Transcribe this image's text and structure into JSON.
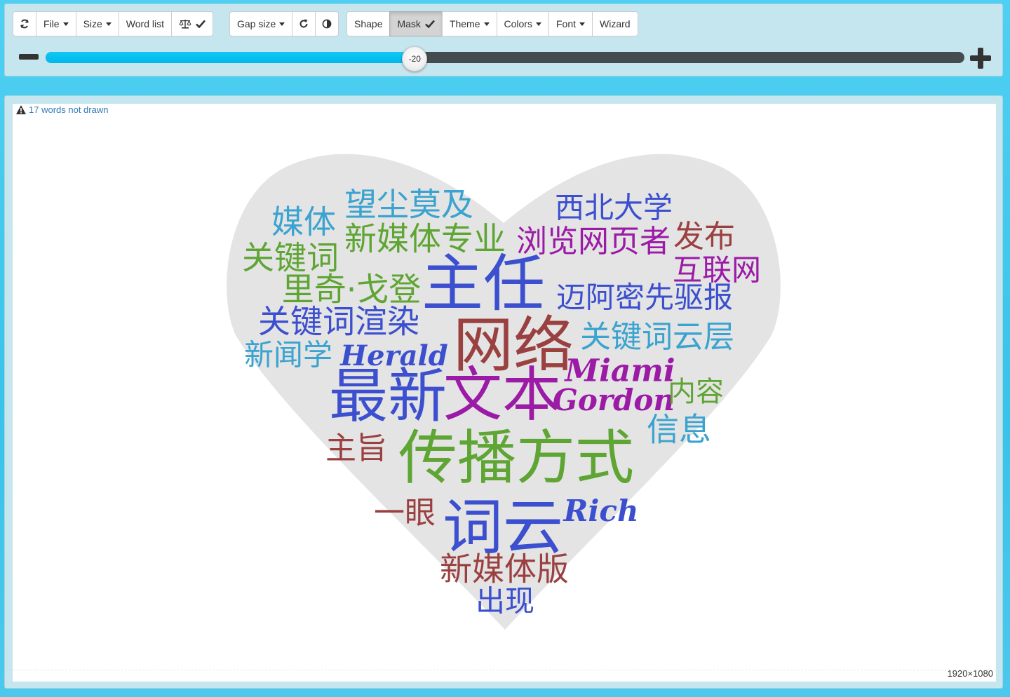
{
  "toolbar": {
    "group1": [
      {
        "name": "refresh-button",
        "icon": "refresh-icon",
        "label": "",
        "caret": false
      },
      {
        "name": "file-menu-button",
        "label": "File",
        "caret": true
      },
      {
        "name": "size-menu-button",
        "label": "Size",
        "caret": true
      },
      {
        "name": "word-list-button",
        "label": "Word list",
        "caret": false
      },
      {
        "name": "balance-button",
        "icon": "balance-scale-icon",
        "label": "",
        "check": true
      }
    ],
    "group2": [
      {
        "name": "gap-size-menu-button",
        "label": "Gap size",
        "caret": true
      },
      {
        "name": "redraw-button",
        "icon": "redo-icon",
        "label": ""
      },
      {
        "name": "contrast-button",
        "icon": "contrast-icon",
        "label": ""
      }
    ],
    "group3": [
      {
        "name": "shape-button",
        "label": "Shape"
      },
      {
        "name": "mask-button",
        "label": "Mask",
        "check": true,
        "active": true
      },
      {
        "name": "theme-menu-button",
        "label": "Theme",
        "caret": true
      },
      {
        "name": "colors-menu-button",
        "label": "Colors",
        "caret": true
      },
      {
        "name": "font-menu-button",
        "label": "Font",
        "caret": true
      },
      {
        "name": "wizard-button",
        "label": "Wizard"
      }
    ]
  },
  "slider": {
    "value": "-20",
    "fraction": 0.401
  },
  "canvas": {
    "warning_text": "17 words not drawn",
    "dimensions": "1920×1080",
    "mask_color": "#e4e4e4"
  },
  "words": [
    {
      "text": "望尘莫及",
      "color": "#3aa3cf"
    },
    {
      "text": "西北大学",
      "color": "#3b4fcf"
    },
    {
      "text": "媒体",
      "color": "#3aa3cf"
    },
    {
      "text": "新媒体专业",
      "color": "#5ea534"
    },
    {
      "text": "浏览网页者",
      "color": "#9b1aa6"
    },
    {
      "text": "发布",
      "color": "#9b4040"
    },
    {
      "text": "关键词",
      "color": "#5ea534"
    },
    {
      "text": "互联网",
      "color": "#9b1aa6"
    },
    {
      "text": "主任",
      "color": "#3b4fcf"
    },
    {
      "text": "里奇·戈登",
      "color": "#5ea534"
    },
    {
      "text": "迈阿密先驱报",
      "color": "#3b4fcf"
    },
    {
      "text": "关键词渲染",
      "color": "#3b4fcf"
    },
    {
      "text": "网络",
      "color": "#9b4040"
    },
    {
      "text": "关键词云层",
      "color": "#3aa3cf"
    },
    {
      "text": "新闻学",
      "color": "#3aa3cf"
    },
    {
      "text": "Herald",
      "color": "#3b4fcf"
    },
    {
      "text": "Miami",
      "color": "#9b1aa6"
    },
    {
      "text": "最新",
      "color": "#3b4fcf"
    },
    {
      "text": "文本",
      "color": "#9b1aa6"
    },
    {
      "text": "Gordon",
      "color": "#9b1aa6"
    },
    {
      "text": "内容",
      "color": "#5ea534"
    },
    {
      "text": "信息",
      "color": "#3aa3cf"
    },
    {
      "text": "主旨",
      "color": "#9b4040"
    },
    {
      "text": "传播方式",
      "color": "#5ea534"
    },
    {
      "text": "一眼",
      "color": "#9b4040"
    },
    {
      "text": "词云",
      "color": "#3b4fcf"
    },
    {
      "text": "Rich",
      "color": "#3b4fcf"
    },
    {
      "text": "新媒体版",
      "color": "#9b4040"
    },
    {
      "text": "出现",
      "color": "#3b4fcf"
    }
  ]
}
